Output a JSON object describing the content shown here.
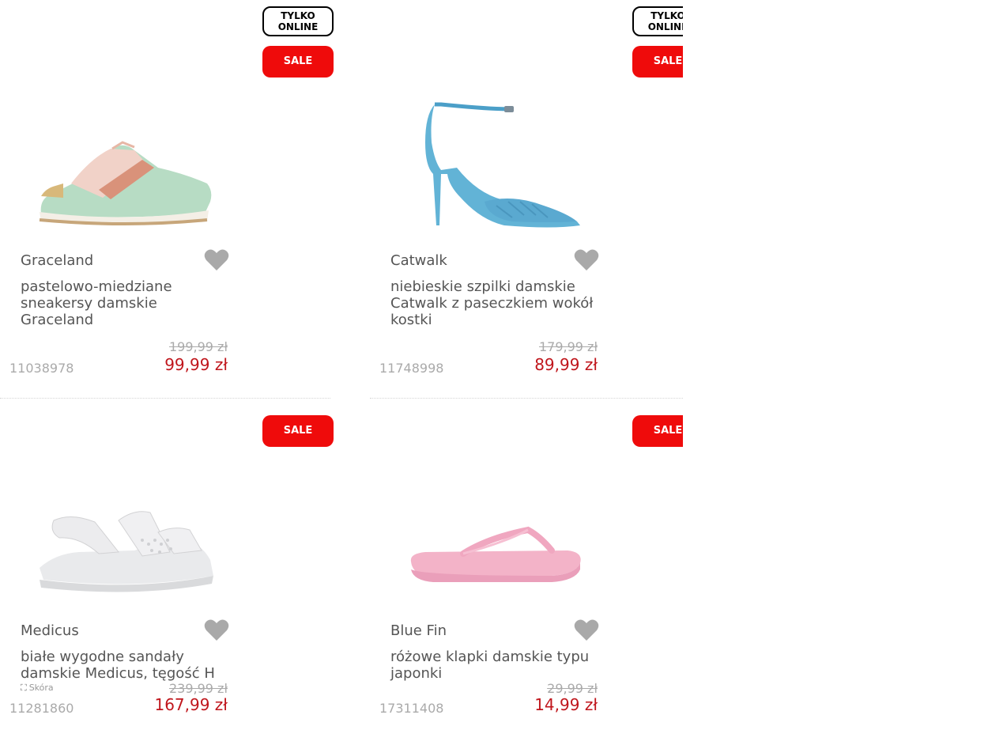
{
  "products": [
    {
      "brand": "Graceland",
      "title": "pastelowo-miedziane sneakersy damskie Graceland",
      "old_price": "199,99 zł",
      "new_price": "99,99 zł",
      "sku": "11038978",
      "badge_online_1": "TYLKO",
      "badge_online_2": "ONLINE",
      "badge_sale": "SALE",
      "image": "pastel sneaker",
      "wishlist_icon": "heart-icon"
    },
    {
      "brand": "Catwalk",
      "title": "niebieskie szpilki damskie Catwalk z paseczkiem wokół kostki",
      "old_price": "179,99 zł",
      "new_price": "89,99 zł",
      "sku": "11748998",
      "badge_online_1": "TYLKO",
      "badge_online_2": "ONLINE",
      "badge_sale": "SALE",
      "image": "blue ankle-strap heel",
      "wishlist_icon": "heart-icon"
    },
    {
      "brand": "Medicus",
      "title": "białe wygodne sandały damskie Medicus, tęgość H",
      "material": "Skóra",
      "old_price": "239,99 zł",
      "new_price": "167,99 zł",
      "sku": "11281860",
      "badge_sale": "SALE",
      "image": "white comfort sandal",
      "wishlist_icon": "heart-icon"
    },
    {
      "brand": "Blue Fin",
      "title": "różowe klapki damskie typu japonki",
      "old_price": "29,99 zł",
      "new_price": "14,99 zł",
      "sku": "17311408",
      "badge_sale": "SALE",
      "image": "pink flip-flop",
      "wishlist_icon": "heart-icon"
    }
  ],
  "colors": {
    "sale_red": "#ef0b0b",
    "price_red": "#c0161c",
    "heart_grey": "#a9a9a9"
  }
}
